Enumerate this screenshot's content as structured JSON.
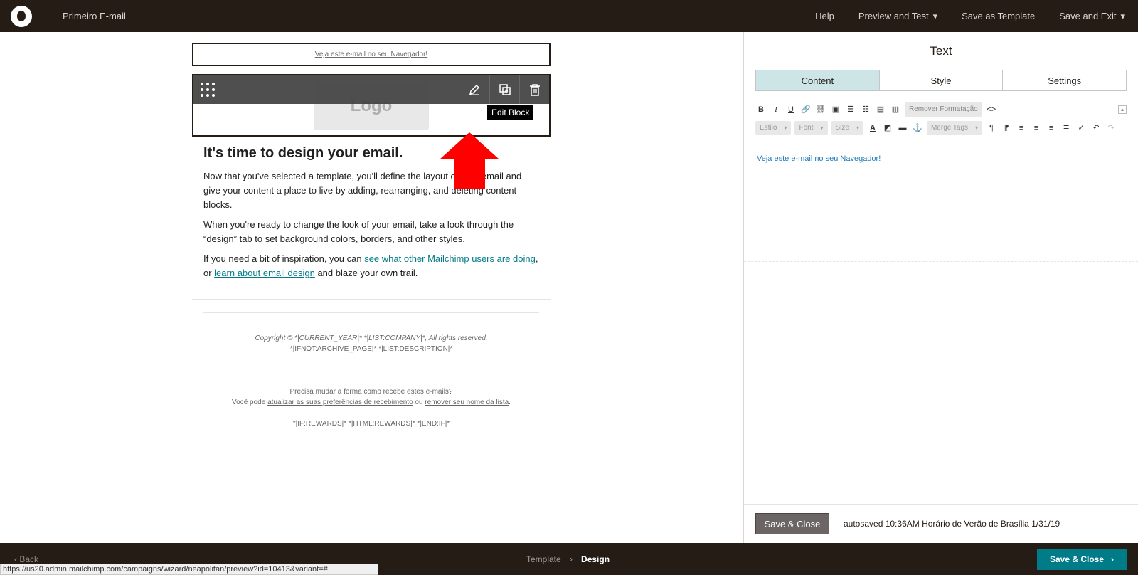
{
  "topbar": {
    "campaign_name": "Primeiro E-mail",
    "help": "Help",
    "preview_test": "Preview and Test",
    "save_template": "Save as Template",
    "save_exit": "Save and Exit"
  },
  "email": {
    "preheader_link": "Veja este e-mail no seu Navegador!",
    "logo_placeholder": "Logo",
    "tooltip": "Edit Block",
    "heading": "It's time to design your email.",
    "p1": "Now that you've selected a template, you'll define the layout of your email and give your content a place to live by adding, rearranging, and deleting content blocks.",
    "p2": "When you're ready to change the look of your email, take a look through the “design” tab to set background colors, borders, and other styles.",
    "p3_before": "If you need a bit of inspiration, you can ",
    "p3_link1": "see what other Mailchimp users are doing",
    "p3_mid": ", or ",
    "p3_link2": "learn about email design",
    "p3_after": " and blaze your own trail.",
    "footer_copyright": "Copyright © *|CURRENT_YEAR|* *|LIST:COMPANY|*, All rights reserved.",
    "footer_archive": "*|IFNOT:ARCHIVE_PAGE|* *|LIST:DESCRIPTION|*",
    "footer_question": "Precisa mudar a forma como recebe estes e-mails?",
    "footer_prefix": "Você pode ",
    "footer_update_link": "atualizar as suas preferências de recebimento",
    "footer_or": " ou ",
    "footer_remove_link": "remover seu nome da lista",
    "footer_period": ".",
    "footer_rewards": "*|IF:REWARDS|* *|HTML:REWARDS|* *|END:IF|*"
  },
  "panel": {
    "title": "Text",
    "tabs": [
      "Content",
      "Style",
      "Settings"
    ],
    "remove_format": "Remover Formatação",
    "style_select": "Estilo",
    "font_select": "Font",
    "size_select": "Size",
    "merge_tags": "Merge Tags",
    "body_link": "Veja este e-mail no seu Navegador!",
    "save_close": "Save & Close",
    "autosave": "autosaved 10:36AM Horário de Verão de Brasília 1/31/19"
  },
  "bottombar": {
    "back": "Back",
    "step_template": "Template",
    "step_design": "Design",
    "save_close": "Save & Close"
  },
  "status_url": "https://us20.admin.mailchimp.com/campaigns/wizard/neapolitan/preview?id=10413&variant=#",
  "colors": {
    "chrome_dark": "#241c15",
    "accent_teal": "#007c89",
    "arrow_red": "#ff0000",
    "tab_active": "#cde5e7"
  }
}
